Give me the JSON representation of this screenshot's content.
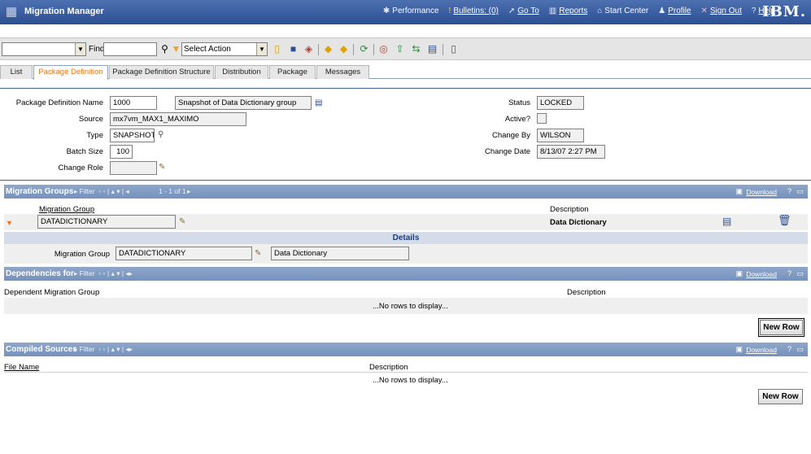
{
  "app": {
    "title": "Migration Manager",
    "brand": "IBM."
  },
  "topnav": [
    {
      "label": "Performance",
      "icon": "✱"
    },
    {
      "label": "Bulletins: (0)",
      "icon": "!"
    },
    {
      "label": "Go To",
      "icon": "➚"
    },
    {
      "label": "Reports",
      "icon": "▥"
    },
    {
      "label": "Start Center",
      "icon": "⌂"
    },
    {
      "label": "Profile",
      "icon": "♟"
    },
    {
      "label": "Sign Out",
      "icon": "✕"
    },
    {
      "label": "Help",
      "icon": "?"
    }
  ],
  "toolbar": {
    "find_label": "Find:",
    "find_value": "",
    "action_select": "Select Action"
  },
  "tabs": [
    {
      "label": "List"
    },
    {
      "label": "Package Definition"
    },
    {
      "label": "Package Definition Structure"
    },
    {
      "label": "Distribution"
    },
    {
      "label": "Package"
    },
    {
      "label": "Messages"
    }
  ],
  "header": {
    "package_definition_name_label": "Package Definition Name",
    "package_definition_name": "1000",
    "package_definition_desc": "Snapshot of Data Dictionary group",
    "source_label": "Source",
    "source": "mx7vm_MAX1_MAXIMO",
    "type_label": "Type",
    "type": "SNAPSHOT",
    "batch_size_label": "Batch Size",
    "batch_size": "100",
    "change_role_label": "Change Role",
    "change_role": "",
    "status_label": "Status",
    "status": "LOCKED",
    "active_label": "Active?",
    "change_by_label": "Change By",
    "change_by": "WILSON",
    "change_date_label": "Change Date",
    "change_date": "8/13/07 2:27 PM"
  },
  "migration_groups": {
    "title": "Migration Groups",
    "filter": "Filter",
    "paging": "1 - 1 of 1",
    "download": "Download",
    "col_group": "Migration Group",
    "col_description": "Description",
    "row": {
      "group": "DATADICTIONARY",
      "description": "Data Dictionary"
    },
    "details_title": "Details",
    "details_group_label": "Migration Group",
    "details_group": "DATADICTIONARY",
    "details_description": "Data Dictionary"
  },
  "dependencies": {
    "title": "Dependencies for",
    "filter": "Filter",
    "download": "Download",
    "col_group": "Dependent Migration Group",
    "col_description": "Description",
    "empty": "...No rows to display...",
    "new_row": "New Row"
  },
  "compiled_sources": {
    "title": "Compiled Sources",
    "filter": "Filter",
    "download": "Download",
    "col_file": "File Name",
    "col_description": "Description",
    "empty": "...No rows to display...",
    "new_row": "New Row"
  }
}
